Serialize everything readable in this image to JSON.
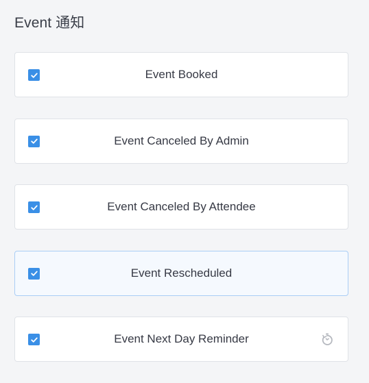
{
  "section": {
    "title": "Event 通知"
  },
  "events": [
    {
      "label": "Event Booked",
      "checked": true,
      "active": false,
      "icon": null
    },
    {
      "label": "Event Canceled By Admin",
      "checked": true,
      "active": false,
      "icon": null
    },
    {
      "label": "Event Canceled By Attendee",
      "checked": true,
      "active": false,
      "icon": null
    },
    {
      "label": "Event Rescheduled",
      "checked": true,
      "active": true,
      "icon": null
    },
    {
      "label": "Event Next Day Reminder",
      "checked": true,
      "active": false,
      "icon": "timer-icon"
    }
  ],
  "colors": {
    "checkbox": "#3a8fe6",
    "active_border": "#a9cdf6",
    "active_background": "#f5f9fe",
    "icon_muted": "#b5b8bf"
  }
}
